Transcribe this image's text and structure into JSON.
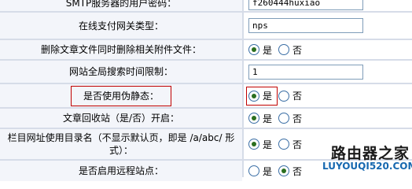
{
  "rows": [
    {
      "label": "SMTP服务器的用户密码：",
      "value": "f260444huxiao"
    },
    {
      "label": "在线支付网关类型：",
      "value": "nps"
    },
    {
      "label": "删除文章文件同时删除相关附件文件：",
      "yes": "是",
      "no": "否",
      "selected": "yes"
    },
    {
      "label": "网站全局搜索时间限制：",
      "value": "1"
    },
    {
      "label": "是否使用伪静态：",
      "yes": "是",
      "no": "否",
      "selected": "yes"
    },
    {
      "label": "文章回收站（是/否）开启：",
      "yes": "是",
      "no": "否",
      "selected": "yes"
    },
    {
      "label_line1": "栏目网址使用目录名（不显示默认页，即是 /a/abc/ 形",
      "label_line2": "式）：",
      "yes": "是",
      "no": "否",
      "selected": "yes"
    },
    {
      "label": "是否启用远程站点：",
      "yes": "是",
      "no": "否",
      "selected": "no"
    }
  ],
  "watermark": {
    "title": "路由器之家",
    "url": "LUYOUQI520.COM"
  }
}
